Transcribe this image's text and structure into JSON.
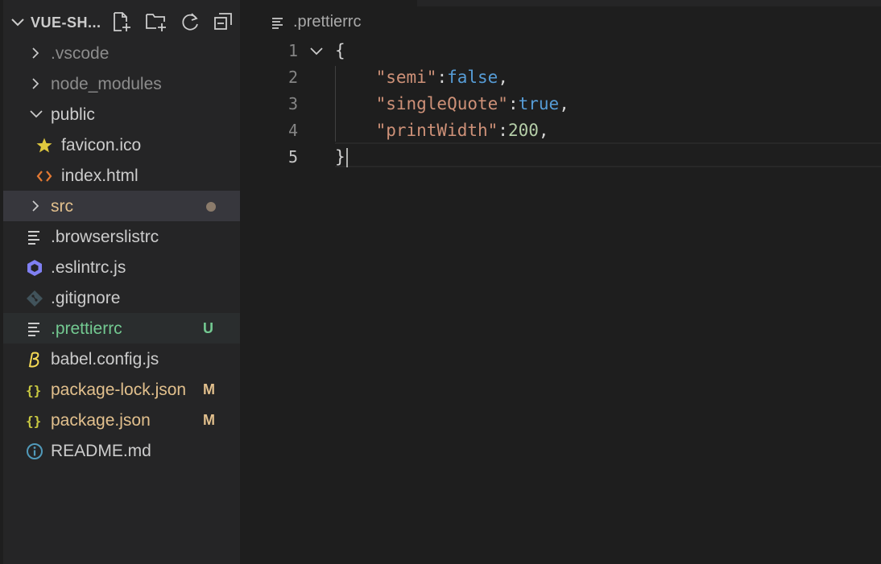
{
  "explorer": {
    "title": "VUE-SH...",
    "actions": [
      "new-file-icon",
      "new-folder-icon",
      "refresh-icon",
      "collapse-all-icon"
    ]
  },
  "tree": [
    {
      "label": ".vscode",
      "kind": "folder",
      "expanded": false,
      "indent": 0,
      "color": "#8c8c8c"
    },
    {
      "label": "node_modules",
      "kind": "folder",
      "expanded": false,
      "indent": 0,
      "color": "#8c8c8c"
    },
    {
      "label": "public",
      "kind": "folder",
      "expanded": true,
      "indent": 0,
      "color": "#cccccc"
    },
    {
      "label": "favicon.ico",
      "kind": "file",
      "icon": "star-icon",
      "indent": 1,
      "color": "#cccccc"
    },
    {
      "label": "index.html",
      "kind": "file",
      "icon": "html-icon",
      "indent": 1,
      "color": "#cccccc"
    },
    {
      "label": "src",
      "kind": "folder",
      "expanded": false,
      "indent": 0,
      "color": "#e2c08d",
      "badge_dot": true
    },
    {
      "label": ".browserslistrc",
      "kind": "file",
      "icon": "text-lines-icon",
      "indent": 0,
      "color": "#cccccc"
    },
    {
      "label": ".eslintrc.js",
      "kind": "file",
      "icon": "eslint-icon",
      "indent": 0,
      "color": "#cccccc"
    },
    {
      "label": ".gitignore",
      "kind": "file",
      "icon": "git-icon",
      "indent": 0,
      "color": "#cccccc"
    },
    {
      "label": ".prettierrc",
      "kind": "file",
      "icon": "text-lines-icon",
      "indent": 0,
      "color": "#73c991",
      "badge": "U",
      "badge_color": "#73c991",
      "selected": true
    },
    {
      "label": "babel.config.js",
      "kind": "file",
      "icon": "babel-icon",
      "indent": 0,
      "color": "#cccccc"
    },
    {
      "label": "package-lock.json",
      "kind": "file",
      "icon": "json-braces-icon",
      "indent": 0,
      "color": "#e2c08d",
      "badge": "M",
      "badge_color": "#e2c08d"
    },
    {
      "label": "package.json",
      "kind": "file",
      "icon": "json-braces-icon",
      "indent": 0,
      "color": "#e2c08d",
      "badge": "M",
      "badge_color": "#e2c08d"
    },
    {
      "label": "README.md",
      "kind": "file",
      "icon": "info-icon",
      "indent": 0,
      "color": "#cccccc"
    }
  ],
  "editor": {
    "breadcrumb": ".prettierrc",
    "lines": [
      {
        "n": "1",
        "tokens": [
          {
            "t": "{",
            "c": "punc"
          }
        ]
      },
      {
        "n": "2",
        "tokens": [
          {
            "t": "    ",
            "c": "punc"
          },
          {
            "t": "\"semi\"",
            "c": "str"
          },
          {
            "t": ":",
            "c": "punc"
          },
          {
            "t": "false",
            "c": "kw"
          },
          {
            "t": ",",
            "c": "punc"
          }
        ]
      },
      {
        "n": "3",
        "tokens": [
          {
            "t": "    ",
            "c": "punc"
          },
          {
            "t": "\"singleQuote\"",
            "c": "str"
          },
          {
            "t": ":",
            "c": "punc"
          },
          {
            "t": "true",
            "c": "kw"
          },
          {
            "t": ",",
            "c": "punc"
          }
        ]
      },
      {
        "n": "4",
        "tokens": [
          {
            "t": "    ",
            "c": "punc"
          },
          {
            "t": "\"printWidth\"",
            "c": "str"
          },
          {
            "t": ":",
            "c": "punc"
          },
          {
            "t": "200",
            "c": "num"
          },
          {
            "t": ",",
            "c": "punc"
          }
        ]
      },
      {
        "n": "5",
        "tokens": [
          {
            "t": "}",
            "c": "punc"
          }
        ]
      }
    ],
    "active_line": "5"
  }
}
